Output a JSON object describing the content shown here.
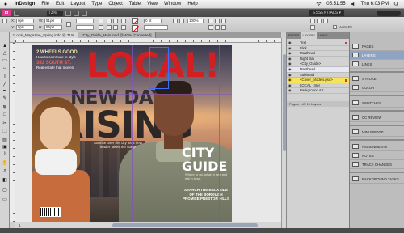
{
  "menubar": {
    "app_name": "InDesign",
    "items": [
      "File",
      "Edit",
      "Layout",
      "Type",
      "Object",
      "Table",
      "View",
      "Window",
      "Help"
    ],
    "clock": "Thu 6:03 PM",
    "battery": "05:51:55"
  },
  "appbar": {
    "logo": "Id",
    "zoom": "73%",
    "workspace": "ESSENTIALS ▾"
  },
  "control": {
    "x_value": "0p0",
    "y_value": "0p0",
    "w_value": "51p0",
    "h_value": "66p0",
    "stroke_weight": "0 pt",
    "opacity": "100%",
    "autofit_label": "Auto-Fit"
  },
  "doc_tabs": [
    {
      "label": "*Local_Magazine_Spring.indd @ 71%",
      "active": true
    },
    {
      "label": "*City_Guide_Main.indd @ 40% [Converted]",
      "active": false
    }
  ],
  "magazine": {
    "masthead": "LOCAL!",
    "headline1": "NEW DAY",
    "headline2": "RISING",
    "tagline": "Sunrise over the city as a new leader takes the stage",
    "left_h1": "2 WHEELS GOOD",
    "left_t1": "How to commute in style",
    "left_h2": "383 SOUTH ST.",
    "left_t2": "Real estate that moves",
    "city": "CITY",
    "guide": "GUIDE",
    "guide_sub": "Where to go, what to see and eat in town",
    "guide_list": "SEARCH THE BACKSIDE OF THE BOROUGH PROMISE PRESTON HILLS"
  },
  "status": {
    "page_number": "1"
  },
  "layers_panel": {
    "tabs": [
      "PAGES",
      "LAYERS",
      "LINKS"
    ],
    "rows": [
      {
        "label": "Text",
        "state": "normal"
      },
      {
        "label": "Flick",
        "state": "normal"
      },
      {
        "label": "Masthead",
        "state": "normal"
      },
      {
        "label": "Right Bar",
        "state": "normal"
      },
      {
        "label": "<City_Guide>",
        "state": "normal"
      },
      {
        "label": "Masthead",
        "state": "highlight"
      },
      {
        "label": "Subhead",
        "state": "normal"
      },
      {
        "label": "<Cover_Models.psd>",
        "state": "selected"
      },
      {
        "label": "LOCAL_Inter",
        "state": "normal"
      },
      {
        "label": "Background Art",
        "state": "normal"
      }
    ],
    "footer": "Pages: 1-2, 10 Layers"
  },
  "dock": {
    "items": [
      {
        "label": "PAGES",
        "icon": "pages-icon",
        "active": false
      },
      {
        "label": "LAYERS",
        "icon": "layers-icon",
        "active": true
      },
      {
        "label": "LINKS",
        "icon": "links-icon",
        "active": false
      },
      {
        "label": "STROKE",
        "icon": "stroke-icon",
        "active": false
      },
      {
        "label": "COLOR",
        "icon": "color-icon",
        "active": false
      },
      {
        "label": "SWATCHES",
        "icon": "swatches-icon",
        "active": false
      },
      {
        "label": "CC REVIEW",
        "icon": "cc-review-icon",
        "active": false
      },
      {
        "label": "MINI BRIDGE",
        "icon": "mini-bridge-icon",
        "active": false
      },
      {
        "label": "ASSIGNMENTS",
        "icon": "assignments-icon",
        "active": false
      },
      {
        "label": "NOTES",
        "icon": "notes-icon",
        "active": false
      },
      {
        "label": "TRACK CHANGES",
        "icon": "track-changes-icon",
        "active": false
      },
      {
        "label": "BACKGROUND TASKS",
        "icon": "background-tasks-icon",
        "active": false
      }
    ]
  },
  "colors": {
    "masthead_red": "#d41f22",
    "selected_layer": "#f7e25a",
    "accent": "#8fa3c4"
  }
}
